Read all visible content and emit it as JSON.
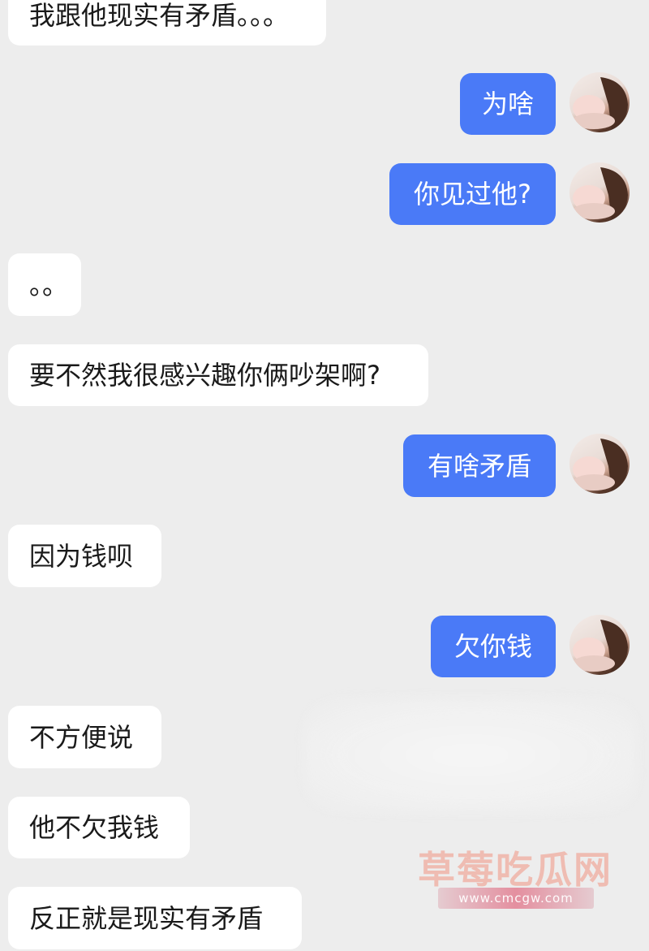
{
  "conversation": {
    "messages": [
      {
        "side": "in",
        "text": "我跟他现实有矛盾。。。"
      },
      {
        "side": "out",
        "text": "为啥"
      },
      {
        "side": "out",
        "text": "你见过他?"
      },
      {
        "side": "in",
        "text": "。。"
      },
      {
        "side": "in",
        "text": "要不然我很感兴趣你俩吵架啊?"
      },
      {
        "side": "out",
        "text": "有啥矛盾"
      },
      {
        "side": "in",
        "text": "因为钱呗"
      },
      {
        "side": "out",
        "text": "欠你钱"
      },
      {
        "side": "in",
        "text": "不方便说"
      },
      {
        "side": "in",
        "text": "他不欠我钱"
      },
      {
        "side": "in",
        "text": "反正就是现实有矛盾"
      }
    ]
  },
  "watermark": {
    "title": "草莓吃瓜网",
    "url": "www.cmcgw.com"
  },
  "colors": {
    "background": "#ededed",
    "incoming_bubble": "#ffffff",
    "outgoing_bubble": "#4a7af7"
  },
  "icons": {
    "avatar": "user-avatar-photo"
  }
}
